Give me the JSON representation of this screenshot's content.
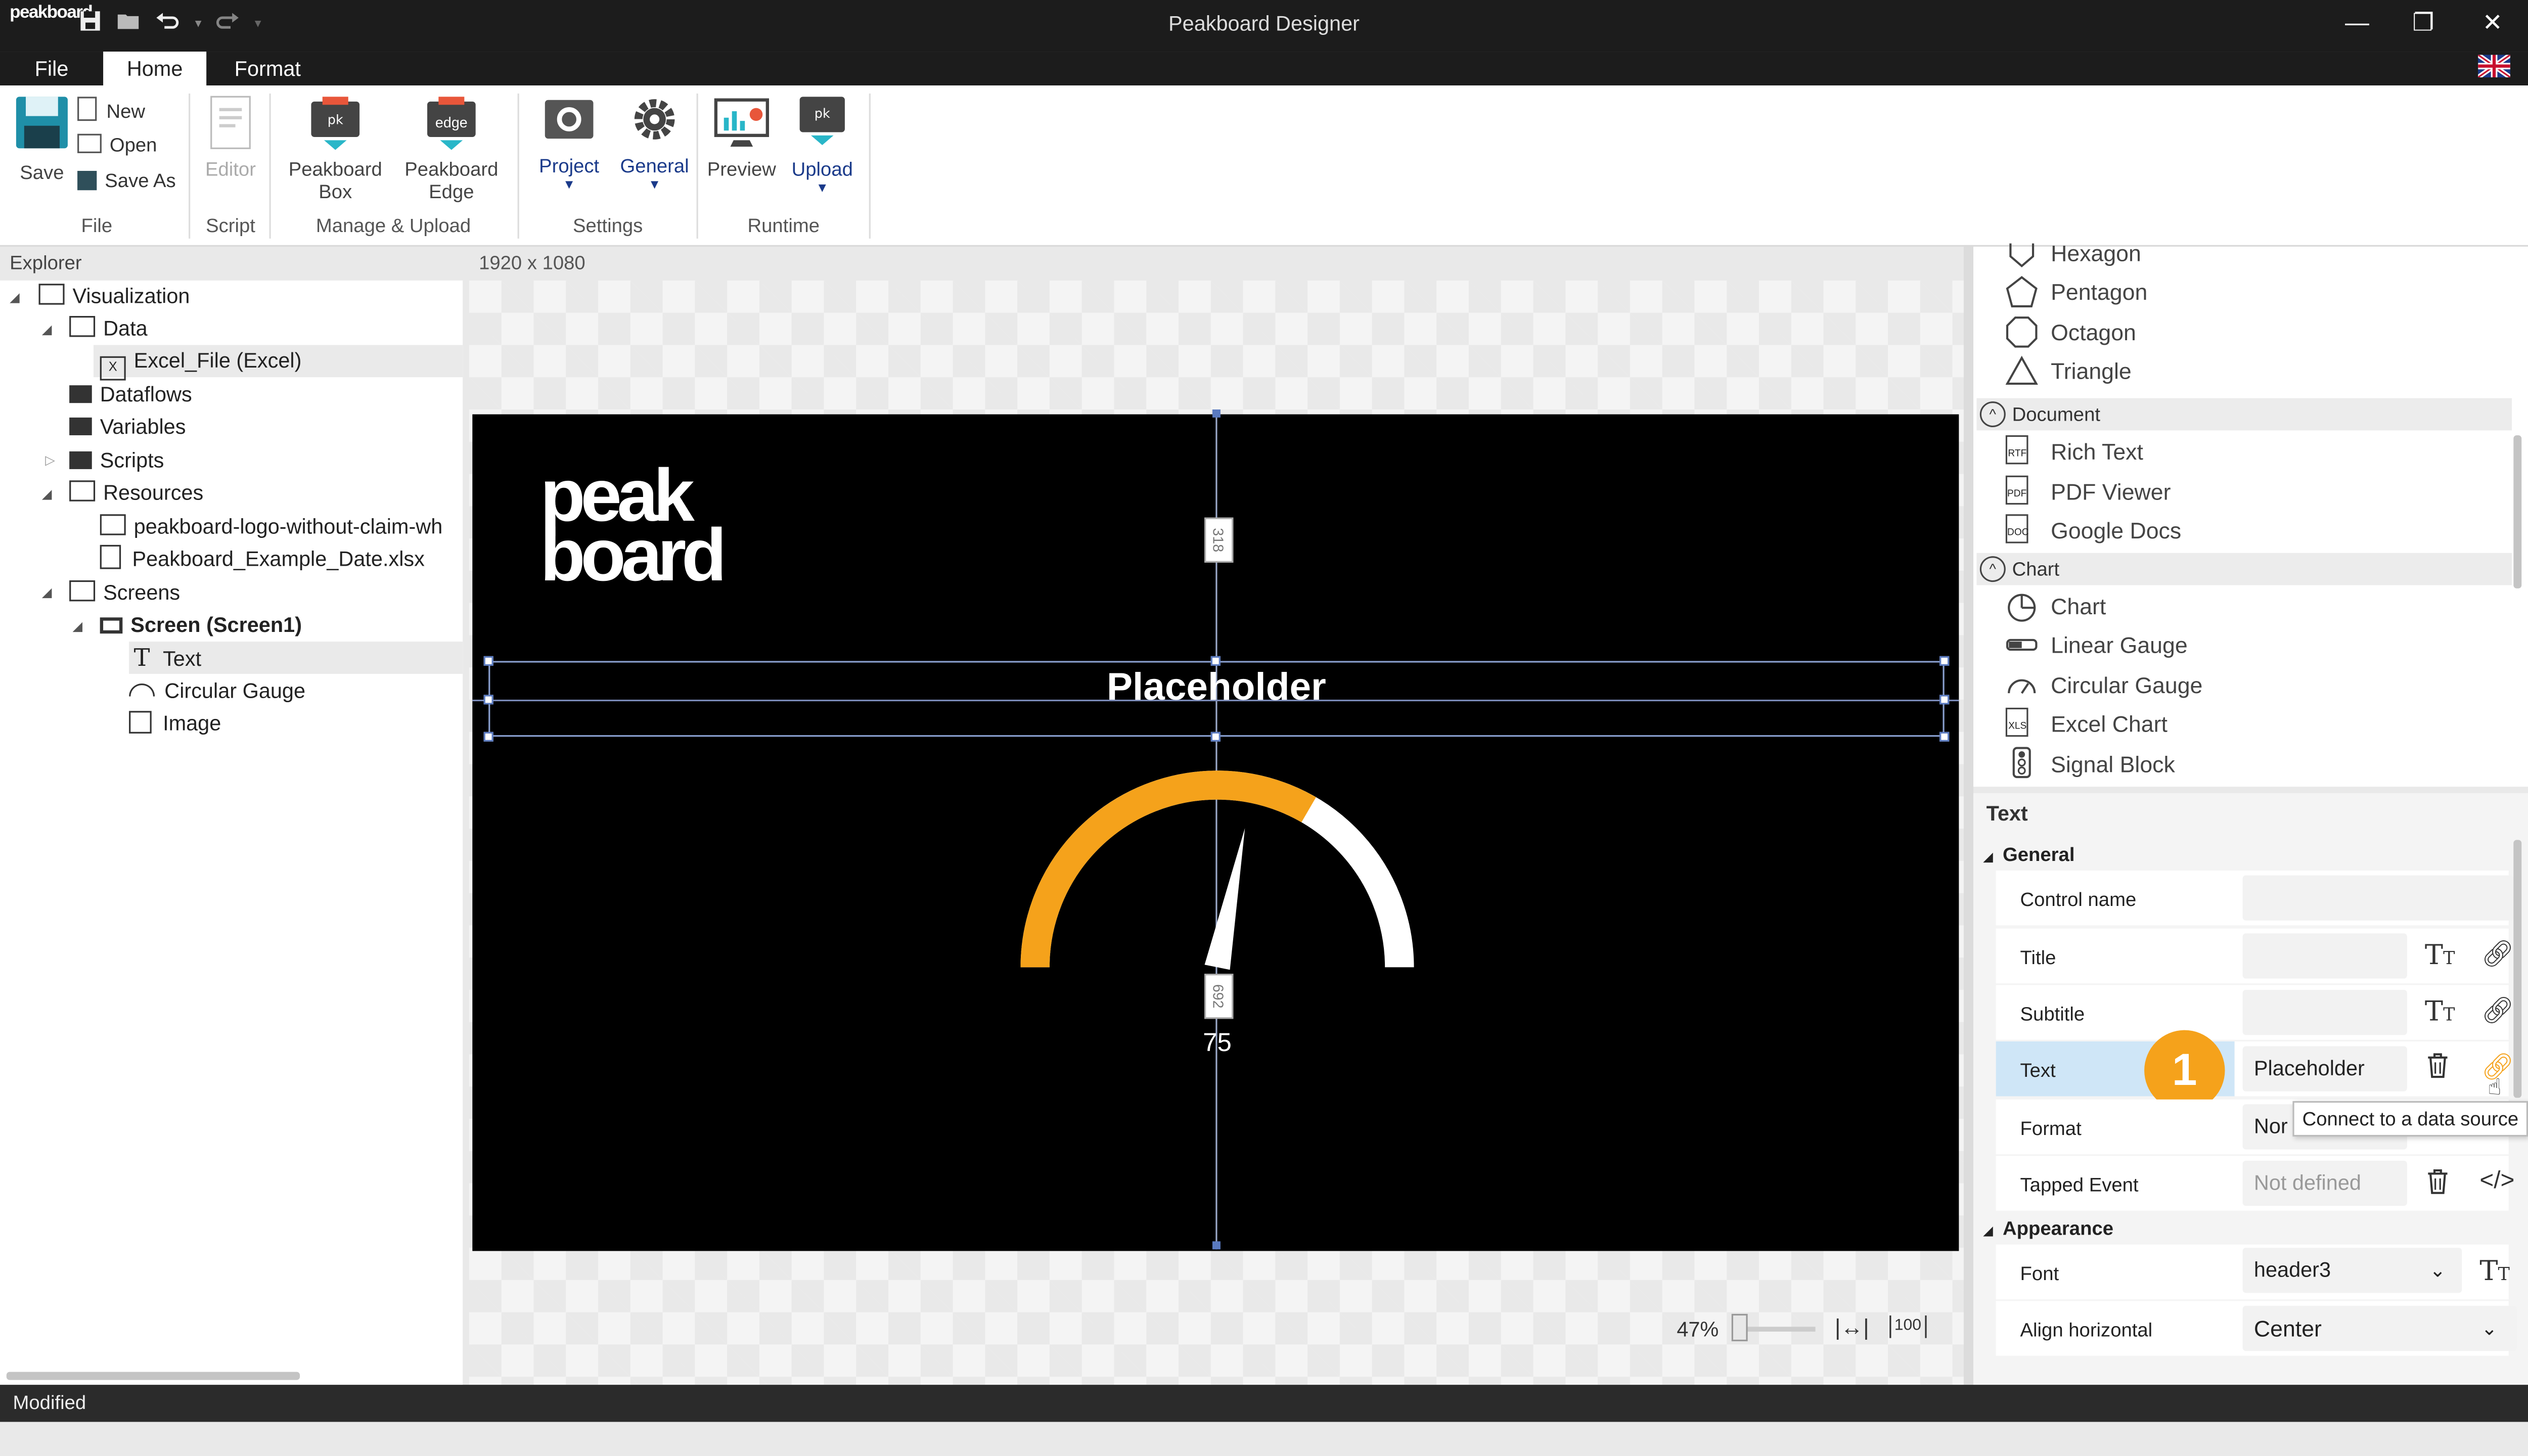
{
  "app": {
    "title": "Peakboard Designer",
    "logo": "peakboard"
  },
  "menu": {
    "tabs": [
      "File",
      "Home",
      "Format"
    ],
    "active": "Home"
  },
  "ribbon": {
    "save": "Save",
    "new": "New",
    "open": "Open",
    "save_as": "Save As",
    "editor": "Editor",
    "peakboard_box": [
      "Peakboard",
      "Box"
    ],
    "peakboard_edge": [
      "Peakboard",
      "Edge"
    ],
    "edge_logo": "edge",
    "project": "Project",
    "general": "General",
    "preview": "Preview",
    "upload": "Upload",
    "groups": {
      "file": "File",
      "script": "Script",
      "manage": "Manage & Upload",
      "settings": "Settings",
      "runtime": "Runtime"
    }
  },
  "explorer": {
    "title": "Explorer",
    "items": [
      {
        "label": "Visualization"
      },
      {
        "label": "Data"
      },
      {
        "label": "Excel_File (Excel)"
      },
      {
        "label": "Dataflows"
      },
      {
        "label": "Variables"
      },
      {
        "label": "Scripts"
      },
      {
        "label": "Resources"
      },
      {
        "label": "peakboard-logo-without-claim-wh"
      },
      {
        "label": "Peakboard_Example_Date.xlsx"
      },
      {
        "label": "Screens"
      },
      {
        "label": "Screen (Screen1)"
      },
      {
        "label": "Text"
      },
      {
        "label": "Circular Gauge"
      },
      {
        "label": "Image"
      }
    ]
  },
  "canvas": {
    "resolution": "1920 x 1080",
    "logo_line1": "peak",
    "logo_line2": "board",
    "placeholder": "Placeholder",
    "gauge_value_label": "75",
    "gauge_fraction": 0.75,
    "measure_top": "318",
    "measure_bottom": "692",
    "zoom": "47%",
    "fit_label": "100",
    "colors": {
      "gauge": "#f5a21b",
      "bg": "#000000",
      "accent": "#ff8c00"
    }
  },
  "toolbox": {
    "shapes": [
      "Hexagon",
      "Pentagon",
      "Octagon",
      "Triangle"
    ],
    "document_header": "Document",
    "documents": [
      "Rich Text",
      "PDF Viewer",
      "Google Docs"
    ],
    "doc_icon_tags": [
      "RTF",
      "PDF",
      "DOC",
      "XLS"
    ],
    "chart_header": "Chart",
    "charts": [
      "Chart",
      "Linear Gauge",
      "Circular Gauge",
      "Excel Chart",
      "Signal Block"
    ]
  },
  "properties": {
    "title": "Text",
    "general_header": "General",
    "rows": [
      {
        "label": "Control name",
        "value": ""
      },
      {
        "label": "Title",
        "value": ""
      },
      {
        "label": "Subtitle",
        "value": ""
      },
      {
        "label": "Text",
        "value": "Placeholder"
      },
      {
        "label": "Format",
        "value": "Nor"
      },
      {
        "label": "Tapped Event",
        "value": "Not defined"
      }
    ],
    "appearance_header": "Appearance",
    "font_label": "Font",
    "font_value": "header3",
    "align_label": "Align horizontal",
    "align_value": "Center",
    "tooltip": "Connect to a data source",
    "step_badge": "1"
  },
  "status": {
    "text": "Modified"
  }
}
